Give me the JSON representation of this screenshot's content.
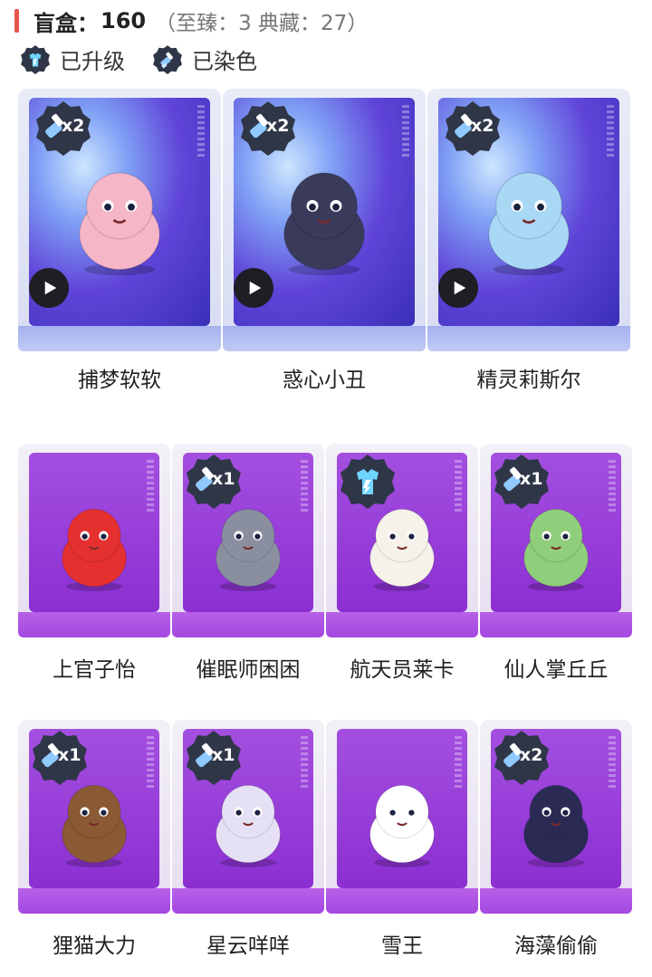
{
  "header": {
    "label": "盲盒：",
    "count": "160",
    "sub": "（至臻：3 典藏：27）",
    "accent_color": "#e8534b"
  },
  "legend": {
    "upgraded": "已升级",
    "dyed": "已染色"
  },
  "items": [
    {
      "name": "捕梦软软",
      "badge": "x2",
      "badge_type": "dyed",
      "has_play": true,
      "tier": "premium",
      "figure_color": "#f5b6c8"
    },
    {
      "name": "惑心小丑",
      "badge": "x2",
      "badge_type": "dyed",
      "has_play": true,
      "tier": "premium",
      "figure_color": "#3a3a5a"
    },
    {
      "name": "精灵莉斯尔",
      "badge": "x2",
      "badge_type": "dyed",
      "has_play": true,
      "tier": "premium",
      "figure_color": "#a9d8f5"
    },
    {
      "name": "上官子怡",
      "badge": "",
      "badge_type": "none",
      "has_play": false,
      "tier": "normal",
      "figure_color": "#e53030"
    },
    {
      "name": "催眠师困困",
      "badge": "x1",
      "badge_type": "dyed",
      "has_play": false,
      "tier": "normal",
      "figure_color": "#8a8fa0"
    },
    {
      "name": "航天员莱卡",
      "badge": "",
      "badge_type": "upgraded",
      "has_play": false,
      "tier": "normal",
      "figure_color": "#f6f2ea"
    },
    {
      "name": "仙人掌丘丘",
      "badge": "x1",
      "badge_type": "dyed",
      "has_play": false,
      "tier": "normal",
      "figure_color": "#8fce7a"
    },
    {
      "name": "狸猫大力",
      "badge": "x1",
      "badge_type": "dyed",
      "has_play": false,
      "tier": "normal",
      "figure_color": "#8a5a34"
    },
    {
      "name": "星云咩咩",
      "badge": "x1",
      "badge_type": "dyed",
      "has_play": false,
      "tier": "normal",
      "figure_color": "#e6e0f5"
    },
    {
      "name": "雪王",
      "badge": "",
      "badge_type": "none",
      "has_play": false,
      "tier": "normal",
      "figure_color": "#ffffff"
    },
    {
      "name": "海藻偷偷",
      "badge": "x2",
      "badge_type": "dyed",
      "has_play": false,
      "tier": "normal",
      "figure_color": "#2a2a55"
    }
  ],
  "colors": {
    "premium_back": "#5b6cf0",
    "normal_back": "#9b3fd8",
    "badge_dark": "#2f3648"
  }
}
